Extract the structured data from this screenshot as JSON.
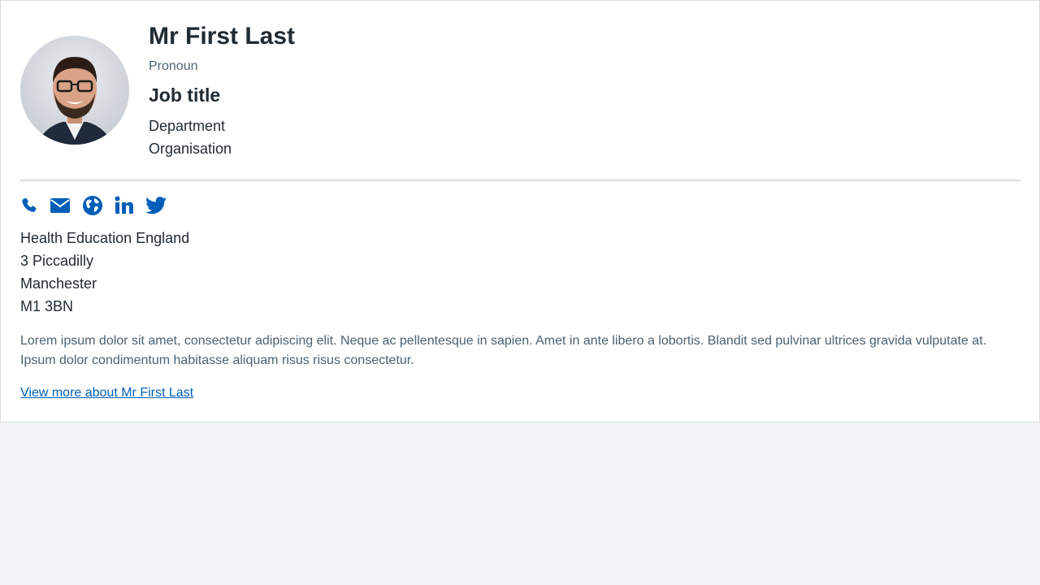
{
  "profile": {
    "name": "Mr First Last",
    "pronoun": "Pronoun",
    "job_title": "Job title",
    "department": "Department",
    "organisation": "Organisation"
  },
  "contact_icons": [
    {
      "icon": "phone-icon"
    },
    {
      "icon": "email-icon"
    },
    {
      "icon": "globe-icon"
    },
    {
      "icon": "linkedin-icon"
    },
    {
      "icon": "twitter-icon"
    }
  ],
  "address": {
    "line1": "Health Education England",
    "line2": "3 Piccadilly",
    "line3": "Manchester",
    "postcode": "M1 3BN"
  },
  "bio": "Lorem ipsum dolor sit amet, consectetur adipiscing elit. Neque ac pellentesque in sapien. Amet in ante libero a lobortis. Blandit sed pulvinar ultrices gravida vulputate at. Ipsum dolor condimentum habitasse aliquam risus risus consectetur.",
  "more_link": "View more about Mr First Last",
  "colors": {
    "accent": "#005eb8",
    "text": "#212b32",
    "secondary_text": "#4c6272",
    "background": "#f0f4f5",
    "border": "#d8dde0"
  }
}
